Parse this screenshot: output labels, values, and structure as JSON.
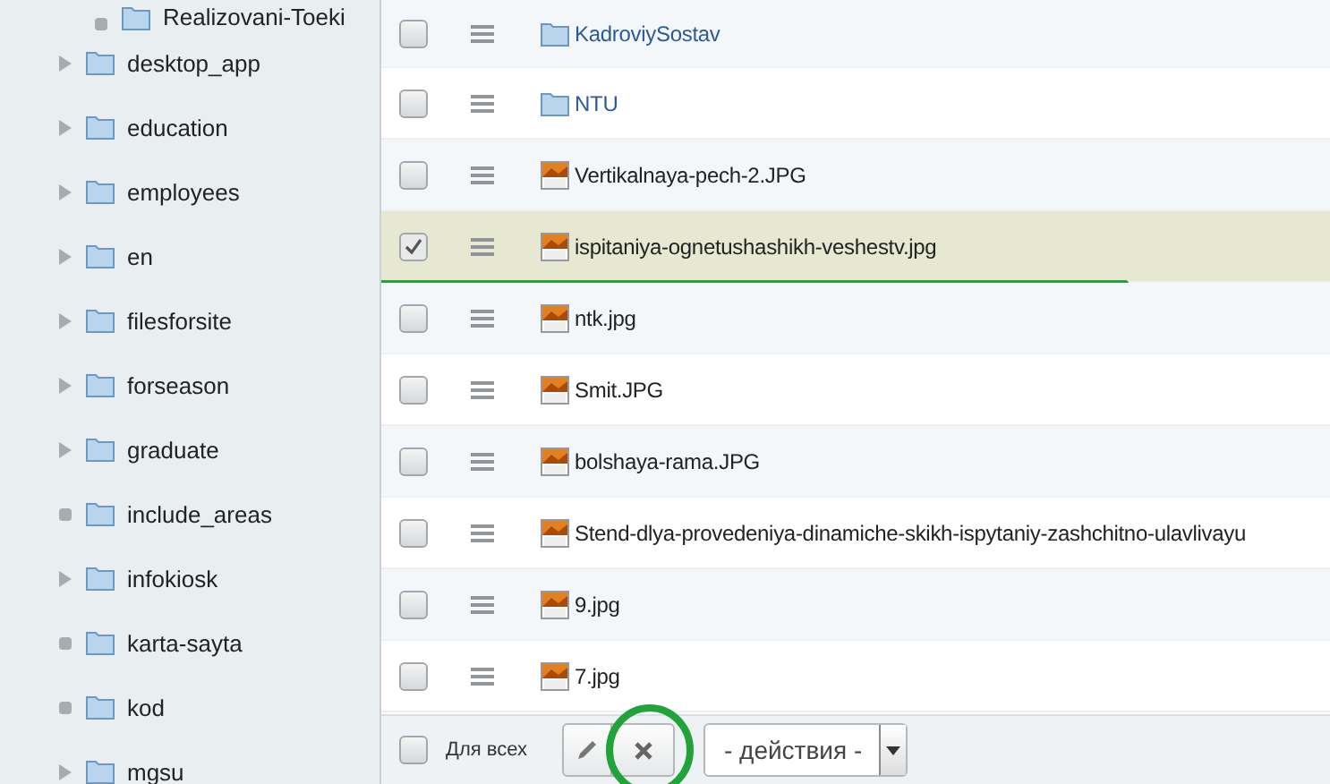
{
  "sidebar": {
    "items": [
      {
        "label": "Realizovani-Toeki",
        "kind": "leaf",
        "child": true
      },
      {
        "label": "desktop_app",
        "kind": "expandable",
        "child": false
      },
      {
        "label": "education",
        "kind": "expandable",
        "child": false
      },
      {
        "label": "employees",
        "kind": "expandable",
        "child": false
      },
      {
        "label": "en",
        "kind": "expandable",
        "child": false
      },
      {
        "label": "filesforsite",
        "kind": "expandable",
        "child": false
      },
      {
        "label": "forseason",
        "kind": "expandable",
        "child": false
      },
      {
        "label": "graduate",
        "kind": "expandable",
        "child": false
      },
      {
        "label": "include_areas",
        "kind": "leaf",
        "child": false
      },
      {
        "label": "infokiosk",
        "kind": "expandable",
        "child": false
      },
      {
        "label": "karta-sayta",
        "kind": "leaf",
        "child": false
      },
      {
        "label": "kod",
        "kind": "leaf",
        "child": false
      },
      {
        "label": "mgsu",
        "kind": "expandable",
        "child": false
      }
    ]
  },
  "files": [
    {
      "name": "KadroviySostav",
      "kind": "folder",
      "checked": false,
      "selected": false
    },
    {
      "name": "NTU",
      "kind": "folder",
      "checked": false,
      "selected": false
    },
    {
      "name": "Vertikalnaya-pech-2.JPG",
      "kind": "jpg",
      "checked": false,
      "selected": false
    },
    {
      "name": "ispitaniya-ognetushashikh-veshestv.jpg",
      "kind": "jpg",
      "checked": true,
      "selected": true
    },
    {
      "name": "ntk.jpg",
      "kind": "jpg",
      "checked": false,
      "selected": false
    },
    {
      "name": "Smit.JPG",
      "kind": "jpg",
      "checked": false,
      "selected": false
    },
    {
      "name": "bolshaya-rama.JPG",
      "kind": "jpg",
      "checked": false,
      "selected": false
    },
    {
      "name": "Stend-dlya-provedeniya-dinamiche-skikh-ispytaniy-zashchitno-ulavlivayu",
      "kind": "jpg",
      "checked": false,
      "selected": false
    },
    {
      "name": "9.jpg",
      "kind": "jpg",
      "checked": false,
      "selected": false
    },
    {
      "name": "7.jpg",
      "kind": "jpg",
      "checked": false,
      "selected": false
    }
  ],
  "footer": {
    "select_all": {
      "label": "Для всех",
      "checked": false
    },
    "actions": {
      "value": "- действия -"
    }
  }
}
